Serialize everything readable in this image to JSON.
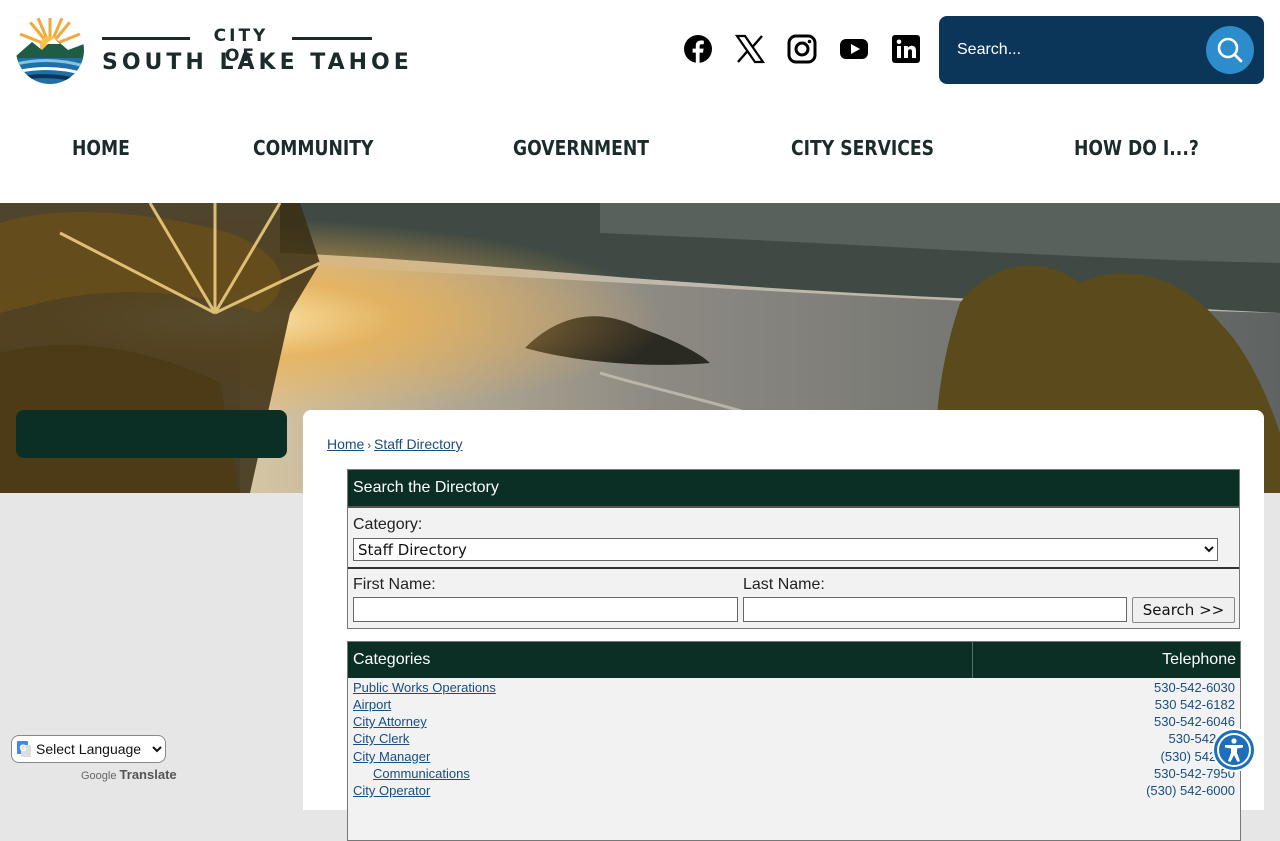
{
  "brand": {
    "line1": "CITY OF",
    "line2": "SOUTH LAKE TAHOE"
  },
  "social": [
    "facebook-icon",
    "x-icon",
    "instagram-icon",
    "youtube-icon",
    "linkedin-icon"
  ],
  "search": {
    "placeholder": "Search..."
  },
  "nav": [
    "HOME",
    "COMMUNITY",
    "GOVERNMENT",
    "CITY SERVICES",
    "HOW DO I...?"
  ],
  "breadcrumb": {
    "home": "Home",
    "current": "Staff Directory"
  },
  "directory": {
    "title": "Search the Directory",
    "category_label": "Category:",
    "category_value": "Staff Directory",
    "first_label": "First Name:",
    "last_label": "Last Name:",
    "button": "Search >>"
  },
  "table": {
    "col_categories": "Categories",
    "col_telephone": "Telephone",
    "rows": [
      {
        "name": "Public Works Operations",
        "tel": "530-542-6030",
        "indent": false
      },
      {
        "name": "Airport",
        "tel": "530 542-6182",
        "indent": false
      },
      {
        "name": "City Attorney",
        "tel": "530-542-6046",
        "indent": false
      },
      {
        "name": "City Clerk",
        "tel": "530-542-60",
        "indent": false
      },
      {
        "name": "City Manager",
        "tel": "(530) 542-60",
        "indent": false
      },
      {
        "name": "Communications",
        "tel": "530-542-7950",
        "indent": true
      },
      {
        "name": "City Operator",
        "tel": "(530) 542-6000",
        "indent": false
      }
    ]
  },
  "translate": {
    "select_label": "Select Language",
    "powered_prefix": "Google",
    "powered_suffix": "Translate"
  },
  "colors": {
    "dark_green": "#0b2e25",
    "navy": "#0b3559",
    "accent_blue": "#2d8ccb",
    "link": "#1a4d80"
  }
}
